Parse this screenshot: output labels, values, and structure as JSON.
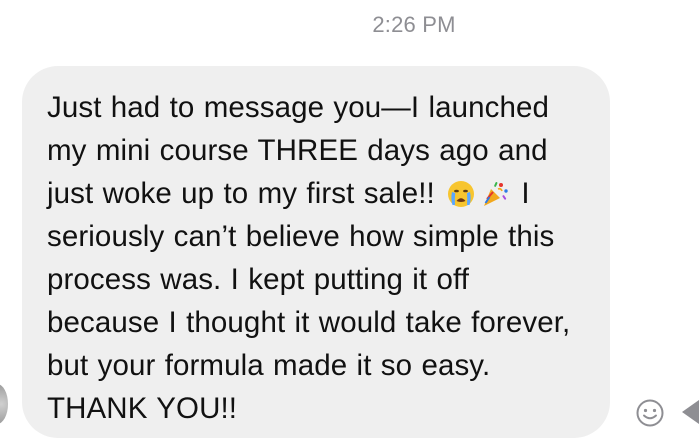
{
  "conversation": {
    "timestamp": "2:26 PM",
    "message": {
      "text_part1": "Just had to message you—I launched my mini course THREE days ago and just woke up to my first sale!! ",
      "emojis": [
        "crying-face-emoji",
        "party-popper-emoji"
      ],
      "text_part2": " I seriously can’t believe how simple this process was. I kept putting it off because I thought it would take forever, but your formula made it so easy. THANK YOU!!"
    }
  },
  "colors": {
    "bubble": "#efefef",
    "timestamp": "#8e8e93",
    "text": "#111111"
  }
}
